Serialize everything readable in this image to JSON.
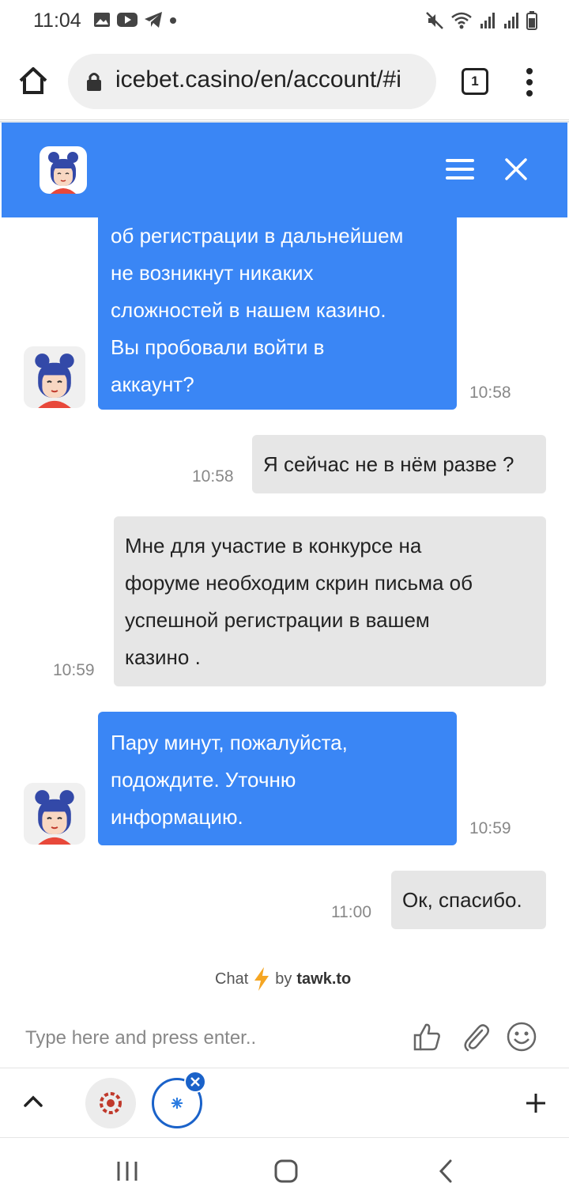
{
  "status_bar": {
    "time": "11:04",
    "left_icons": [
      "gallery-icon",
      "youtube-icon",
      "telegram-icon",
      "dot-icon"
    ],
    "right_icons": [
      "mute-icon",
      "wifi-icon",
      "signal-icon",
      "signal-icon",
      "battery-icon"
    ]
  },
  "browser": {
    "url": "icebet.casino/en/account/#i",
    "tab_count": "1"
  },
  "chat": {
    "header": {
      "avatar": "agent-avatar",
      "menu_icon": "hamburger-icon",
      "close_icon": "close-icon"
    },
    "messages": [
      {
        "sender": "agent",
        "lines": [
          "об регистрации в дальнейшем",
          "не возникнут никаких",
          "сложностей в нашем казино.",
          "Вы пробовали войти в",
          "аккаунт?"
        ],
        "time": "10:58"
      },
      {
        "sender": "user",
        "lines": [
          "Я сейчас не в нём разве ?"
        ],
        "time": "10:58"
      },
      {
        "sender": "user",
        "lines": [
          "Мне для участие в конкурсе на",
          "форуме необходим скрин письма об",
          "успешной регистрации в вашем",
          "казино ."
        ],
        "time": "10:59"
      },
      {
        "sender": "agent",
        "lines": [
          "Пару минут, пожалуйста,",
          "подождите. Уточню",
          "информацию."
        ],
        "time": "10:59"
      },
      {
        "sender": "user",
        "lines": [
          "Ок, спасибо."
        ],
        "time": "11:00"
      }
    ],
    "branding": {
      "prefix": "Chat",
      "by": "by",
      "name": "tawk.to"
    },
    "composer": {
      "placeholder": "Type here and press enter..",
      "icons": [
        "thumbs-up-icon",
        "paperclip-icon",
        "emoji-icon"
      ]
    }
  },
  "bottom_tabs": {
    "icons": [
      "chevron-up-icon",
      "casino-chip-icon",
      "snowflake-icon",
      "plus-icon"
    ]
  },
  "colors": {
    "accent": "#3a86f5",
    "user_bubble": "#e6e6e6"
  }
}
